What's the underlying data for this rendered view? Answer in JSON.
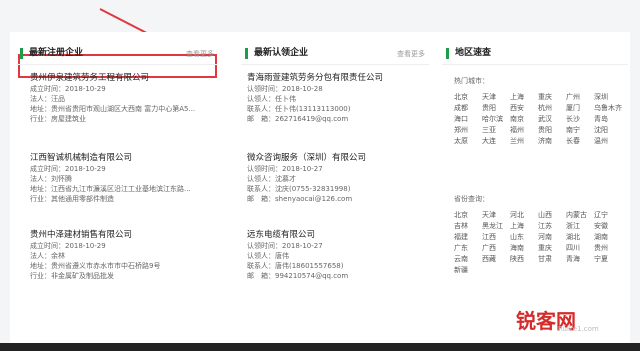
{
  "left": {
    "title": "最新注册企业",
    "more": "查看更多",
    "entries": [
      {
        "name": "贵州伊泉建筑劳务工程有限公司",
        "l1": "成立时间：2018-10-29",
        "l2": "法人：汪品",
        "l3": "地址：贵州省贵阳市观山湖区大西南 富力中心第A5...",
        "l4": "行业：房屋建筑业"
      },
      {
        "name": "江西智诚机械制造有限公司",
        "l1": "成立时间：2018-10-29",
        "l2": "法人：刘怀腾",
        "l3": "地址：江西省九江市濂溪区沿江工业基地滨江东路...",
        "l4": "行业：其他通用零部件制造"
      },
      {
        "name": "贵州中泽建材销售有限公司",
        "l1": "成立时间：2018-10-29",
        "l2": "法人：余林",
        "l3": "地址：贵州省遵义市赤水市市中石桥路9号",
        "l4": "行业：非金属矿及制品批发"
      }
    ]
  },
  "middle": {
    "title": "最新认领企业",
    "more": "查看更多",
    "entries": [
      {
        "name": "青海雨萱建筑劳务分包有限责任公司",
        "l1": "认领时间：2018-10-28",
        "l2": "认领人：任卜伟",
        "l3": "联系人：任卜伟(13113113000)",
        "l4": "邮　箱：262716419@qq.com"
      },
      {
        "name": "微众咨询服务（深圳）有限公司",
        "l1": "认领时间：2018-10-27",
        "l2": "认领人：沈慕才",
        "l3": "联系人：沈庆(0755-32831998)",
        "l4": "邮　箱：shenyaocai@126.com"
      },
      {
        "name": "远东电缆有限公司",
        "l1": "认领时间：2018-10-27",
        "l2": "认领人：唐伟",
        "l3": "联系人：唐伟(18601557658)",
        "l4": "邮　箱：994210574@qq.com"
      }
    ]
  },
  "right": {
    "title": "地区速查",
    "hot_label": "热门城市：",
    "hot_cities": [
      "北京",
      "天津",
      "上海",
      "重庆",
      "广州",
      "深圳",
      "成都",
      "贵阳",
      "西安",
      "杭州",
      "厦门",
      "乌鲁木齐",
      "海口",
      "哈尔滨",
      "南京",
      "武汉",
      "长沙",
      "青岛",
      "郑州",
      "三亚",
      "福州",
      "贵阳",
      "南宁",
      "沈阳",
      "太原",
      "大连",
      "兰州",
      "济南",
      "长春",
      "温州"
    ],
    "prov_label": "省份查询：",
    "provinces": [
      "北京",
      "天津",
      "河北",
      "山西",
      "内蒙古",
      "辽宁",
      "吉林",
      "黑龙江",
      "上海",
      "江苏",
      "浙江",
      "安徽",
      "福建",
      "江西",
      "山东",
      "河南",
      "湖北",
      "湖南",
      "广东",
      "广西",
      "海南",
      "重庆",
      "四川",
      "贵州",
      "云南",
      "西藏",
      "陕西",
      "甘肃",
      "青海",
      "宁夏",
      "新疆"
    ]
  },
  "watermark": {
    "main": "锐客网",
    "sub": "Ruike1.com"
  },
  "colors": {
    "accent": "#1e9b4b",
    "highlight": "#e0383e"
  }
}
